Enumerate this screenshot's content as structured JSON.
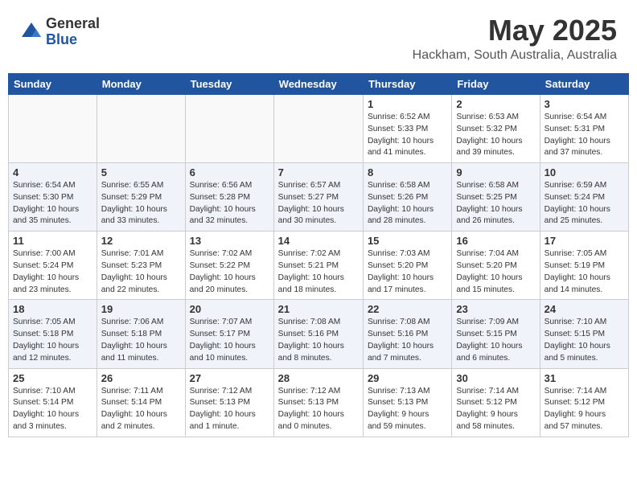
{
  "logo": {
    "general": "General",
    "blue": "Blue"
  },
  "title": "May 2025",
  "subtitle": "Hackham, South Australia, Australia",
  "weekdays": [
    "Sunday",
    "Monday",
    "Tuesday",
    "Wednesday",
    "Thursday",
    "Friday",
    "Saturday"
  ],
  "weeks": [
    [
      {
        "day": "",
        "info": ""
      },
      {
        "day": "",
        "info": ""
      },
      {
        "day": "",
        "info": ""
      },
      {
        "day": "",
        "info": ""
      },
      {
        "day": "1",
        "info": "Sunrise: 6:52 AM\nSunset: 5:33 PM\nDaylight: 10 hours\nand 41 minutes."
      },
      {
        "day": "2",
        "info": "Sunrise: 6:53 AM\nSunset: 5:32 PM\nDaylight: 10 hours\nand 39 minutes."
      },
      {
        "day": "3",
        "info": "Sunrise: 6:54 AM\nSunset: 5:31 PM\nDaylight: 10 hours\nand 37 minutes."
      }
    ],
    [
      {
        "day": "4",
        "info": "Sunrise: 6:54 AM\nSunset: 5:30 PM\nDaylight: 10 hours\nand 35 minutes."
      },
      {
        "day": "5",
        "info": "Sunrise: 6:55 AM\nSunset: 5:29 PM\nDaylight: 10 hours\nand 33 minutes."
      },
      {
        "day": "6",
        "info": "Sunrise: 6:56 AM\nSunset: 5:28 PM\nDaylight: 10 hours\nand 32 minutes."
      },
      {
        "day": "7",
        "info": "Sunrise: 6:57 AM\nSunset: 5:27 PM\nDaylight: 10 hours\nand 30 minutes."
      },
      {
        "day": "8",
        "info": "Sunrise: 6:58 AM\nSunset: 5:26 PM\nDaylight: 10 hours\nand 28 minutes."
      },
      {
        "day": "9",
        "info": "Sunrise: 6:58 AM\nSunset: 5:25 PM\nDaylight: 10 hours\nand 26 minutes."
      },
      {
        "day": "10",
        "info": "Sunrise: 6:59 AM\nSunset: 5:24 PM\nDaylight: 10 hours\nand 25 minutes."
      }
    ],
    [
      {
        "day": "11",
        "info": "Sunrise: 7:00 AM\nSunset: 5:24 PM\nDaylight: 10 hours\nand 23 minutes."
      },
      {
        "day": "12",
        "info": "Sunrise: 7:01 AM\nSunset: 5:23 PM\nDaylight: 10 hours\nand 22 minutes."
      },
      {
        "day": "13",
        "info": "Sunrise: 7:02 AM\nSunset: 5:22 PM\nDaylight: 10 hours\nand 20 minutes."
      },
      {
        "day": "14",
        "info": "Sunrise: 7:02 AM\nSunset: 5:21 PM\nDaylight: 10 hours\nand 18 minutes."
      },
      {
        "day": "15",
        "info": "Sunrise: 7:03 AM\nSunset: 5:20 PM\nDaylight: 10 hours\nand 17 minutes."
      },
      {
        "day": "16",
        "info": "Sunrise: 7:04 AM\nSunset: 5:20 PM\nDaylight: 10 hours\nand 15 minutes."
      },
      {
        "day": "17",
        "info": "Sunrise: 7:05 AM\nSunset: 5:19 PM\nDaylight: 10 hours\nand 14 minutes."
      }
    ],
    [
      {
        "day": "18",
        "info": "Sunrise: 7:05 AM\nSunset: 5:18 PM\nDaylight: 10 hours\nand 12 minutes."
      },
      {
        "day": "19",
        "info": "Sunrise: 7:06 AM\nSunset: 5:18 PM\nDaylight: 10 hours\nand 11 minutes."
      },
      {
        "day": "20",
        "info": "Sunrise: 7:07 AM\nSunset: 5:17 PM\nDaylight: 10 hours\nand 10 minutes."
      },
      {
        "day": "21",
        "info": "Sunrise: 7:08 AM\nSunset: 5:16 PM\nDaylight: 10 hours\nand 8 minutes."
      },
      {
        "day": "22",
        "info": "Sunrise: 7:08 AM\nSunset: 5:16 PM\nDaylight: 10 hours\nand 7 minutes."
      },
      {
        "day": "23",
        "info": "Sunrise: 7:09 AM\nSunset: 5:15 PM\nDaylight: 10 hours\nand 6 minutes."
      },
      {
        "day": "24",
        "info": "Sunrise: 7:10 AM\nSunset: 5:15 PM\nDaylight: 10 hours\nand 5 minutes."
      }
    ],
    [
      {
        "day": "25",
        "info": "Sunrise: 7:10 AM\nSunset: 5:14 PM\nDaylight: 10 hours\nand 3 minutes."
      },
      {
        "day": "26",
        "info": "Sunrise: 7:11 AM\nSunset: 5:14 PM\nDaylight: 10 hours\nand 2 minutes."
      },
      {
        "day": "27",
        "info": "Sunrise: 7:12 AM\nSunset: 5:13 PM\nDaylight: 10 hours\nand 1 minute."
      },
      {
        "day": "28",
        "info": "Sunrise: 7:12 AM\nSunset: 5:13 PM\nDaylight: 10 hours\nand 0 minutes."
      },
      {
        "day": "29",
        "info": "Sunrise: 7:13 AM\nSunset: 5:13 PM\nDaylight: 9 hours\nand 59 minutes."
      },
      {
        "day": "30",
        "info": "Sunrise: 7:14 AM\nSunset: 5:12 PM\nDaylight: 9 hours\nand 58 minutes."
      },
      {
        "day": "31",
        "info": "Sunrise: 7:14 AM\nSunset: 5:12 PM\nDaylight: 9 hours\nand 57 minutes."
      }
    ]
  ]
}
